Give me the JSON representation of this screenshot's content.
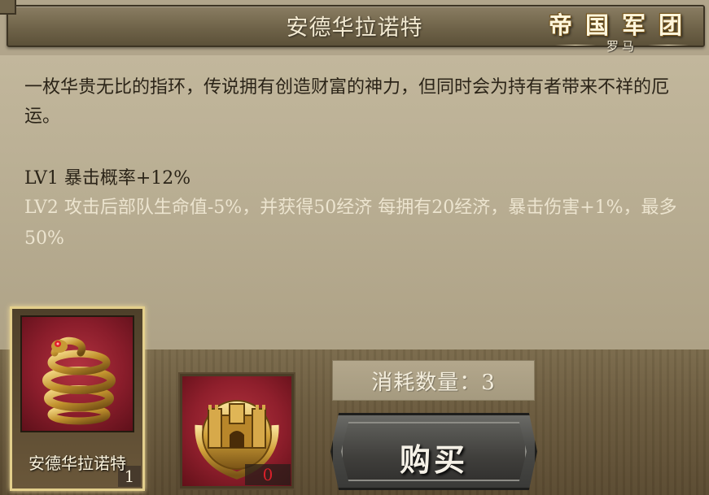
{
  "header": {
    "title": "安德华拉诺特"
  },
  "logo": {
    "main": "帝国军团",
    "sub": "罗马"
  },
  "description": {
    "text": "一枚华贵无比的指环，传说拥有创造财富的神力，但同时会为持有者带来不祥的厄运。",
    "lv1": "LV1 暴击概率+12%",
    "lv2": "LV2 攻击后部队生命值-5%，并获得50经济  每拥有20经济，暴击伤害+1%，最多50%"
  },
  "items": [
    {
      "name": "安德华拉诺特",
      "count": "1",
      "icon": "snake-ring-icon"
    },
    {
      "count": "0",
      "icon": "castle-laurel-icon"
    }
  ],
  "purchase": {
    "consume_label": "消耗数量：3",
    "buy_label": "购买"
  },
  "colors": {
    "parchment": "#b8ad92",
    "title_bar": "#6f6349",
    "item_bg": "#8a1d2b",
    "count_red": "#d8202a",
    "card_border_gold": "#e3cf8c"
  }
}
